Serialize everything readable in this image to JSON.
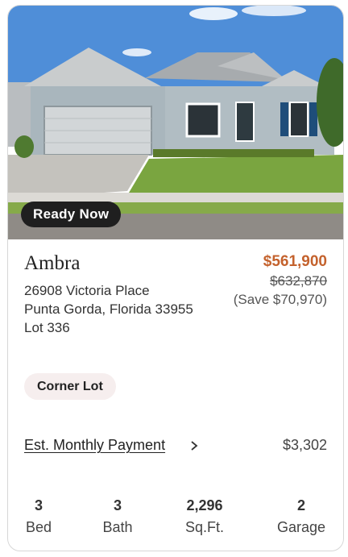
{
  "listing": {
    "status_badge": "Ready Now",
    "model_name": "Ambra",
    "address_line1": "26908 Victoria Place",
    "address_line2": "Punta Gorda, Florida 33955",
    "lot": "Lot 336",
    "price_current": "$561,900",
    "price_original": "$632,870",
    "price_savings": "(Save $70,970)",
    "feature_tag": "Corner Lot",
    "payment_label": "Est. Monthly Payment",
    "payment_value": "$3,302",
    "stats": [
      {
        "value": "3",
        "label": "Bed"
      },
      {
        "value": "3",
        "label": "Bath"
      },
      {
        "value": "2,296",
        "label": "Sq.Ft."
      },
      {
        "value": "2",
        "label": "Garage"
      }
    ]
  },
  "colors": {
    "accent_price": "#c4622d",
    "badge_bg": "#1f1f1f",
    "tag_bg": "#f6eeee"
  }
}
